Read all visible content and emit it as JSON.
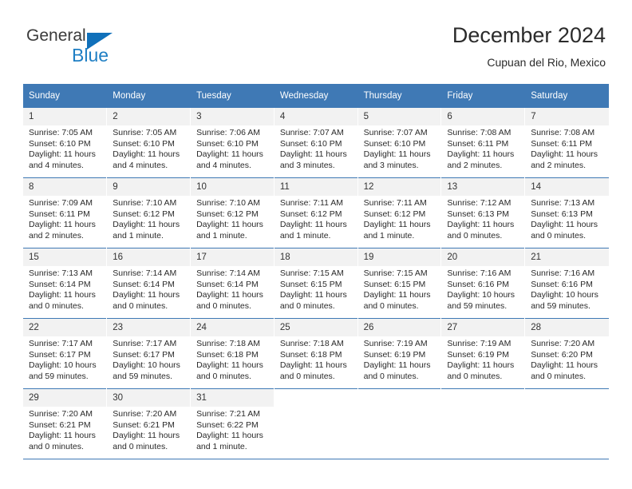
{
  "brand": {
    "name_top": "General",
    "name_bottom": "Blue",
    "accent_color": "#1f7fc4",
    "triangle_color": "#1070ba"
  },
  "header": {
    "month_title": "December 2024",
    "location": "Cupuan del Rio, Mexico"
  },
  "theme": {
    "header_row_bg": "#3f79b5",
    "daynum_bg": "#f2f2f2",
    "text_color": "#2a2a2a"
  },
  "calendar": {
    "weekday_headers": [
      "Sunday",
      "Monday",
      "Tuesday",
      "Wednesday",
      "Thursday",
      "Friday",
      "Saturday"
    ],
    "labels": {
      "sunrise": "Sunrise:",
      "sunset": "Sunset:",
      "daylight": "Daylight:"
    },
    "weeks": [
      [
        {
          "day": "1",
          "sunrise": "Sunrise: 7:05 AM",
          "sunset": "Sunset: 6:10 PM",
          "daylight_line1": "Daylight: 11 hours",
          "daylight_line2": "and 4 minutes."
        },
        {
          "day": "2",
          "sunrise": "Sunrise: 7:05 AM",
          "sunset": "Sunset: 6:10 PM",
          "daylight_line1": "Daylight: 11 hours",
          "daylight_line2": "and 4 minutes."
        },
        {
          "day": "3",
          "sunrise": "Sunrise: 7:06 AM",
          "sunset": "Sunset: 6:10 PM",
          "daylight_line1": "Daylight: 11 hours",
          "daylight_line2": "and 4 minutes."
        },
        {
          "day": "4",
          "sunrise": "Sunrise: 7:07 AM",
          "sunset": "Sunset: 6:10 PM",
          "daylight_line1": "Daylight: 11 hours",
          "daylight_line2": "and 3 minutes."
        },
        {
          "day": "5",
          "sunrise": "Sunrise: 7:07 AM",
          "sunset": "Sunset: 6:10 PM",
          "daylight_line1": "Daylight: 11 hours",
          "daylight_line2": "and 3 minutes."
        },
        {
          "day": "6",
          "sunrise": "Sunrise: 7:08 AM",
          "sunset": "Sunset: 6:11 PM",
          "daylight_line1": "Daylight: 11 hours",
          "daylight_line2": "and 2 minutes."
        },
        {
          "day": "7",
          "sunrise": "Sunrise: 7:08 AM",
          "sunset": "Sunset: 6:11 PM",
          "daylight_line1": "Daylight: 11 hours",
          "daylight_line2": "and 2 minutes."
        }
      ],
      [
        {
          "day": "8",
          "sunrise": "Sunrise: 7:09 AM",
          "sunset": "Sunset: 6:11 PM",
          "daylight_line1": "Daylight: 11 hours",
          "daylight_line2": "and 2 minutes."
        },
        {
          "day": "9",
          "sunrise": "Sunrise: 7:10 AM",
          "sunset": "Sunset: 6:12 PM",
          "daylight_line1": "Daylight: 11 hours",
          "daylight_line2": "and 1 minute."
        },
        {
          "day": "10",
          "sunrise": "Sunrise: 7:10 AM",
          "sunset": "Sunset: 6:12 PM",
          "daylight_line1": "Daylight: 11 hours",
          "daylight_line2": "and 1 minute."
        },
        {
          "day": "11",
          "sunrise": "Sunrise: 7:11 AM",
          "sunset": "Sunset: 6:12 PM",
          "daylight_line1": "Daylight: 11 hours",
          "daylight_line2": "and 1 minute."
        },
        {
          "day": "12",
          "sunrise": "Sunrise: 7:11 AM",
          "sunset": "Sunset: 6:12 PM",
          "daylight_line1": "Daylight: 11 hours",
          "daylight_line2": "and 1 minute."
        },
        {
          "day": "13",
          "sunrise": "Sunrise: 7:12 AM",
          "sunset": "Sunset: 6:13 PM",
          "daylight_line1": "Daylight: 11 hours",
          "daylight_line2": "and 0 minutes."
        },
        {
          "day": "14",
          "sunrise": "Sunrise: 7:13 AM",
          "sunset": "Sunset: 6:13 PM",
          "daylight_line1": "Daylight: 11 hours",
          "daylight_line2": "and 0 minutes."
        }
      ],
      [
        {
          "day": "15",
          "sunrise": "Sunrise: 7:13 AM",
          "sunset": "Sunset: 6:14 PM",
          "daylight_line1": "Daylight: 11 hours",
          "daylight_line2": "and 0 minutes."
        },
        {
          "day": "16",
          "sunrise": "Sunrise: 7:14 AM",
          "sunset": "Sunset: 6:14 PM",
          "daylight_line1": "Daylight: 11 hours",
          "daylight_line2": "and 0 minutes."
        },
        {
          "day": "17",
          "sunrise": "Sunrise: 7:14 AM",
          "sunset": "Sunset: 6:14 PM",
          "daylight_line1": "Daylight: 11 hours",
          "daylight_line2": "and 0 minutes."
        },
        {
          "day": "18",
          "sunrise": "Sunrise: 7:15 AM",
          "sunset": "Sunset: 6:15 PM",
          "daylight_line1": "Daylight: 11 hours",
          "daylight_line2": "and 0 minutes."
        },
        {
          "day": "19",
          "sunrise": "Sunrise: 7:15 AM",
          "sunset": "Sunset: 6:15 PM",
          "daylight_line1": "Daylight: 11 hours",
          "daylight_line2": "and 0 minutes."
        },
        {
          "day": "20",
          "sunrise": "Sunrise: 7:16 AM",
          "sunset": "Sunset: 6:16 PM",
          "daylight_line1": "Daylight: 10 hours",
          "daylight_line2": "and 59 minutes."
        },
        {
          "day": "21",
          "sunrise": "Sunrise: 7:16 AM",
          "sunset": "Sunset: 6:16 PM",
          "daylight_line1": "Daylight: 10 hours",
          "daylight_line2": "and 59 minutes."
        }
      ],
      [
        {
          "day": "22",
          "sunrise": "Sunrise: 7:17 AM",
          "sunset": "Sunset: 6:17 PM",
          "daylight_line1": "Daylight: 10 hours",
          "daylight_line2": "and 59 minutes."
        },
        {
          "day": "23",
          "sunrise": "Sunrise: 7:17 AM",
          "sunset": "Sunset: 6:17 PM",
          "daylight_line1": "Daylight: 10 hours",
          "daylight_line2": "and 59 minutes."
        },
        {
          "day": "24",
          "sunrise": "Sunrise: 7:18 AM",
          "sunset": "Sunset: 6:18 PM",
          "daylight_line1": "Daylight: 11 hours",
          "daylight_line2": "and 0 minutes."
        },
        {
          "day": "25",
          "sunrise": "Sunrise: 7:18 AM",
          "sunset": "Sunset: 6:18 PM",
          "daylight_line1": "Daylight: 11 hours",
          "daylight_line2": "and 0 minutes."
        },
        {
          "day": "26",
          "sunrise": "Sunrise: 7:19 AM",
          "sunset": "Sunset: 6:19 PM",
          "daylight_line1": "Daylight: 11 hours",
          "daylight_line2": "and 0 minutes."
        },
        {
          "day": "27",
          "sunrise": "Sunrise: 7:19 AM",
          "sunset": "Sunset: 6:19 PM",
          "daylight_line1": "Daylight: 11 hours",
          "daylight_line2": "and 0 minutes."
        },
        {
          "day": "28",
          "sunrise": "Sunrise: 7:20 AM",
          "sunset": "Sunset: 6:20 PM",
          "daylight_line1": "Daylight: 11 hours",
          "daylight_line2": "and 0 minutes."
        }
      ],
      [
        {
          "day": "29",
          "sunrise": "Sunrise: 7:20 AM",
          "sunset": "Sunset: 6:21 PM",
          "daylight_line1": "Daylight: 11 hours",
          "daylight_line2": "and 0 minutes."
        },
        {
          "day": "30",
          "sunrise": "Sunrise: 7:20 AM",
          "sunset": "Sunset: 6:21 PM",
          "daylight_line1": "Daylight: 11 hours",
          "daylight_line2": "and 0 minutes."
        },
        {
          "day": "31",
          "sunrise": "Sunrise: 7:21 AM",
          "sunset": "Sunset: 6:22 PM",
          "daylight_line1": "Daylight: 11 hours",
          "daylight_line2": "and 1 minute."
        },
        {
          "day": "",
          "sunrise": "",
          "sunset": "",
          "daylight_line1": "",
          "daylight_line2": ""
        },
        {
          "day": "",
          "sunrise": "",
          "sunset": "",
          "daylight_line1": "",
          "daylight_line2": ""
        },
        {
          "day": "",
          "sunrise": "",
          "sunset": "",
          "daylight_line1": "",
          "daylight_line2": ""
        },
        {
          "day": "",
          "sunrise": "",
          "sunset": "",
          "daylight_line1": "",
          "daylight_line2": ""
        }
      ]
    ]
  }
}
